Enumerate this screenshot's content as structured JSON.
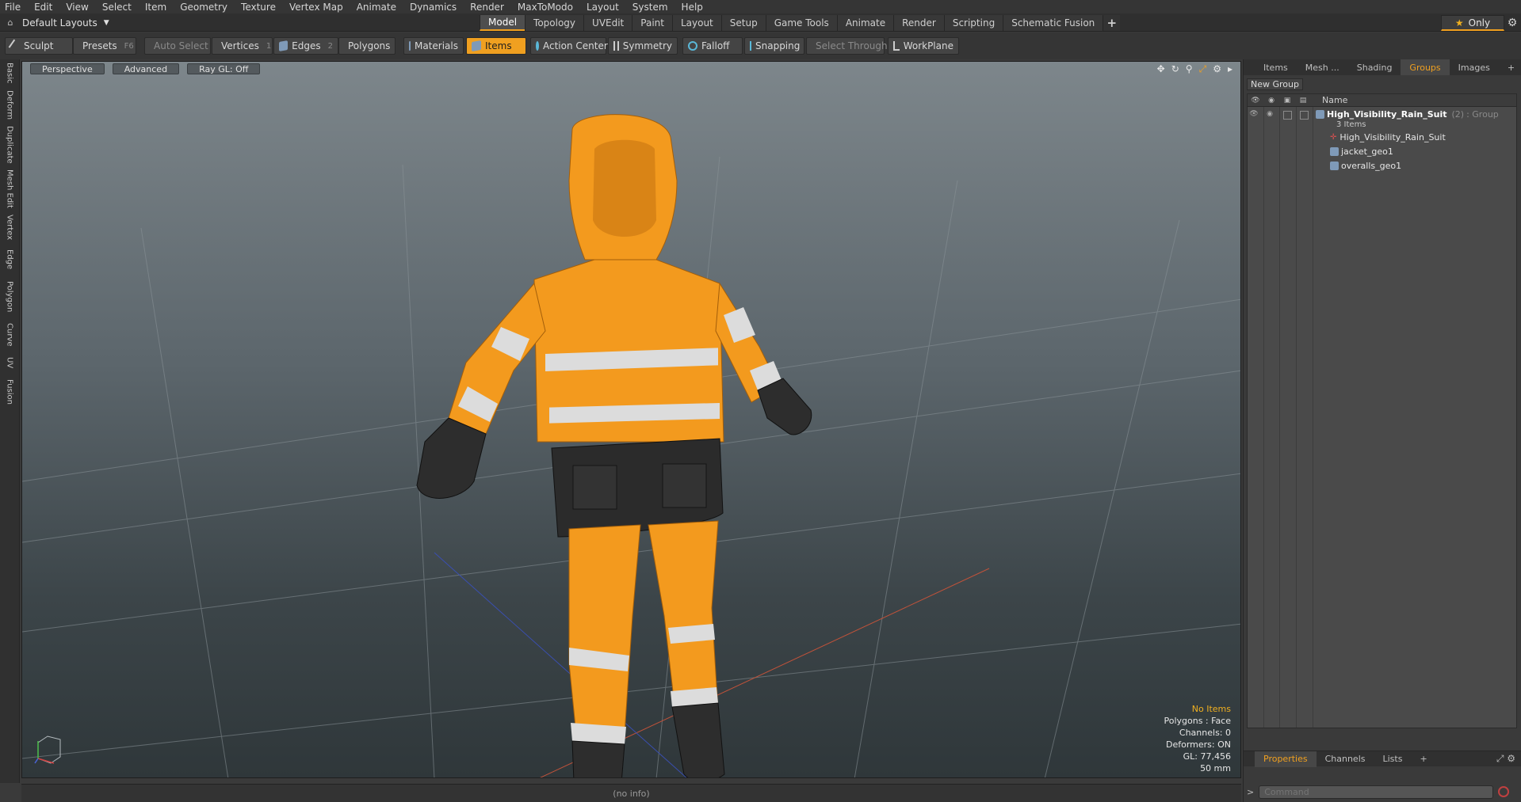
{
  "menu": [
    "File",
    "Edit",
    "View",
    "Select",
    "Item",
    "Geometry",
    "Texture",
    "Vertex Map",
    "Animate",
    "Dynamics",
    "Render",
    "MaxToModo",
    "Layout",
    "System",
    "Help"
  ],
  "layout_switcher": {
    "label": "Default Layouts",
    "icon": "layout-icon"
  },
  "tabs": [
    {
      "label": "Model",
      "active": true
    },
    {
      "label": "Topology"
    },
    {
      "label": "UVEdit"
    },
    {
      "label": "Paint"
    },
    {
      "label": "Layout"
    },
    {
      "label": "Setup"
    },
    {
      "label": "Game Tools"
    },
    {
      "label": "Animate"
    },
    {
      "label": "Render"
    },
    {
      "label": "Scripting"
    },
    {
      "label": "Schematic Fusion"
    }
  ],
  "tab_add": "+",
  "only_button": "Only",
  "toolbar": {
    "sculpt": "Sculpt",
    "presets": "Presets",
    "presets_key": "F6",
    "auto_select": "Auto Select",
    "vertices": "Vertices",
    "vertices_key": "1",
    "edges": "Edges",
    "edges_key": "2",
    "polygons": "Polygons",
    "materials": "Materials",
    "items": "Items",
    "action_center": "Action Center",
    "symmetry": "Symmetry",
    "falloff": "Falloff",
    "snapping": "Snapping",
    "select_through": "Select Through",
    "workplane": "WorkPlane"
  },
  "left_tabs": [
    "Basic",
    "Deform",
    "Duplicate",
    "Mesh Edit",
    "Vertex",
    "Edge",
    "Polygon",
    "Curve",
    "UV",
    "Fusion"
  ],
  "viewport": {
    "perspective": "Perspective",
    "advanced": "Advanced",
    "raygl": "Ray GL: Off",
    "icons": [
      "move-view-icon",
      "rotate-view-icon",
      "zoom-view-icon",
      "fit-view-icon",
      "settings-icon",
      "expand-icon"
    ]
  },
  "hud": {
    "no_items": "No Items",
    "polygons": "Polygons : Face",
    "channels": "Channels: 0",
    "deformers": "Deformers: ON",
    "gl": "GL: 77,456",
    "focal": "50 mm"
  },
  "status": "(no info)",
  "right_panel": {
    "tabs": [
      {
        "label": "Items"
      },
      {
        "label": "Mesh ..."
      },
      {
        "label": "Shading"
      },
      {
        "label": "Groups",
        "active": true
      },
      {
        "label": "Images"
      }
    ],
    "tab_add": "+",
    "new_group": "New Group",
    "name_header": "Name",
    "group": {
      "name": "High_Visibility_Rain_Suit",
      "count": "(2)",
      "type": ": Group",
      "items_count": "3 Items",
      "children": [
        "High_Visibility_Rain_Suit",
        "jacket_geo1",
        "overalls_geo1"
      ]
    },
    "bottom_tabs": [
      {
        "label": "Properties",
        "active": true
      },
      {
        "label": "Channels"
      },
      {
        "label": "Lists"
      }
    ],
    "bottom_add": "+",
    "command_placeholder": "Command"
  },
  "colors": {
    "accent": "#f0a020",
    "suit_orange": "#f39a1e",
    "suit_black": "#2b2b2b",
    "reflective": "#d8d8d8"
  }
}
